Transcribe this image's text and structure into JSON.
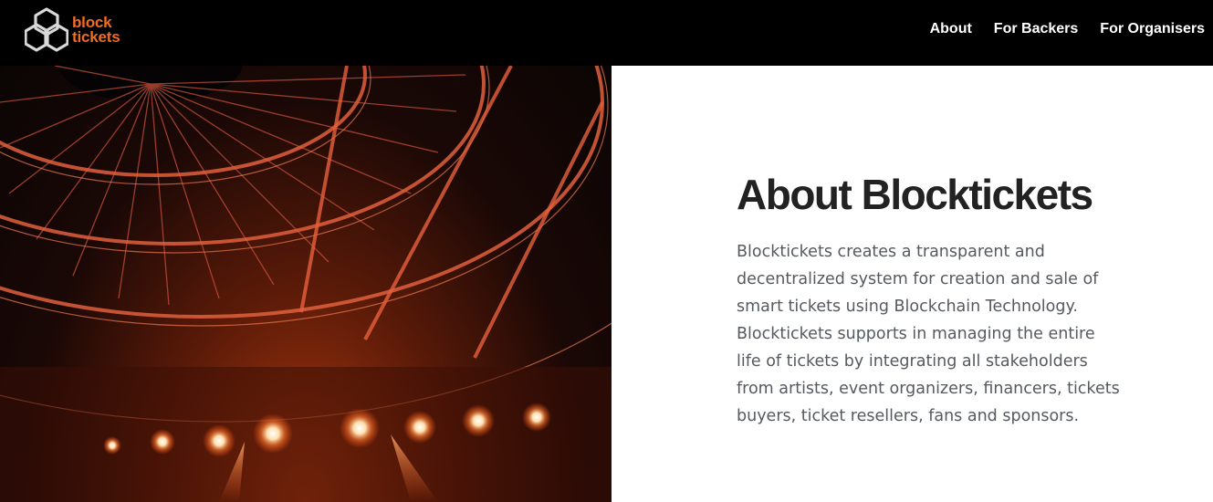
{
  "brand": {
    "line1": "block",
    "line2": "tickets",
    "accent": "#f26b21"
  },
  "nav": {
    "items": [
      {
        "label": "About"
      },
      {
        "label": "For Backers"
      },
      {
        "label": "For Organisers"
      }
    ]
  },
  "hero": {
    "image": "concert-stage-truss-photo"
  },
  "about": {
    "title": "About Blocktickets",
    "description": "Blocktickets creates a transparent and decentralized system for creation and sale of smart tickets using Blockchain Technology. Blocktickets supports in managing the entire life of tickets by integrating all stakeholders from artists, event organizers, financers, tickets buyers, ticket resellers, fans and sponsors."
  }
}
